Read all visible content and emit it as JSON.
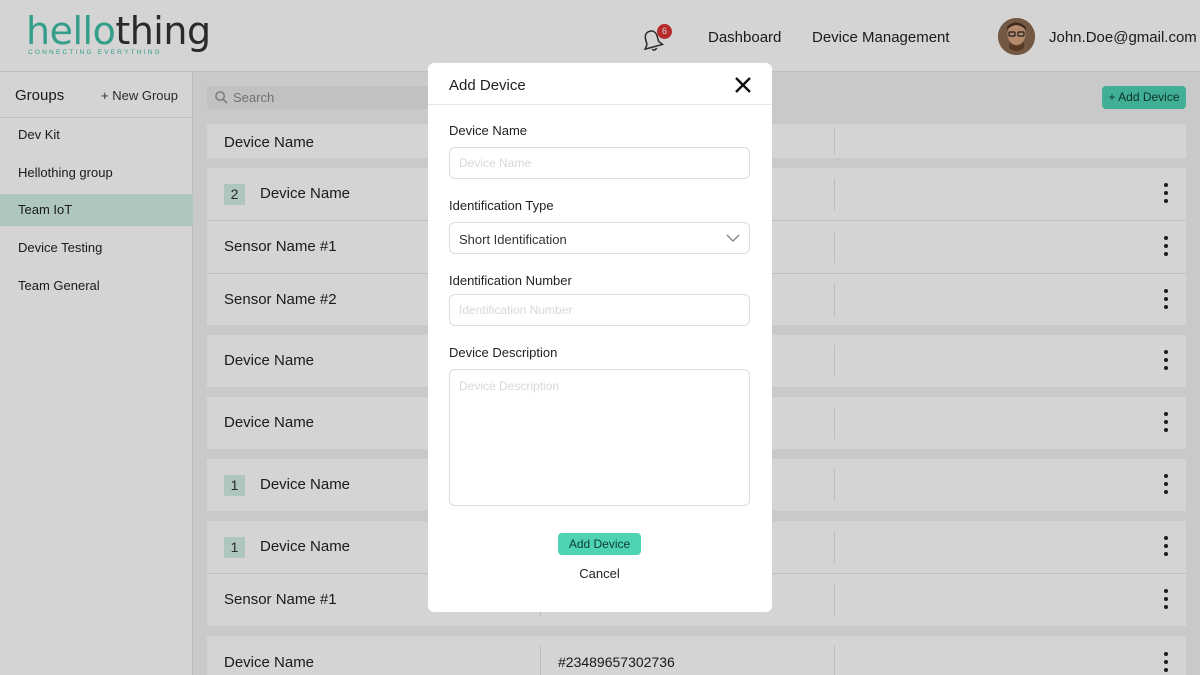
{
  "header": {
    "logo_part1": "hello",
    "logo_part2": "thing",
    "logo_tagline": "CONNECTING EVERYTHING",
    "notification_count": "6",
    "nav": [
      "Dashboard",
      "Device Management"
    ],
    "user_email": "John.Doe@gmail.com"
  },
  "sidebar": {
    "title": "Groups",
    "new_group": "+ New Group",
    "items": [
      {
        "label": "Dev Kit",
        "active": false
      },
      {
        "label": "Hellothing group",
        "active": false
      },
      {
        "label": "Team IoT",
        "active": true
      },
      {
        "label": "Device Testing",
        "active": false
      },
      {
        "label": "Team General",
        "active": false
      }
    ]
  },
  "main": {
    "search_placeholder": "Search",
    "add_device_label": "+ Add Device",
    "column_header": "Device Name",
    "rows": [
      {
        "num": "2",
        "name": "Device Name",
        "id": ""
      },
      {
        "num": "",
        "name": "Sensor Name #1",
        "id": ""
      },
      {
        "num": "",
        "name": "Sensor Name #2",
        "id": ""
      },
      {
        "num": "",
        "name": "Device Name",
        "id": ""
      },
      {
        "num": "",
        "name": "Device Name",
        "id": ""
      },
      {
        "num": "1",
        "name": "Device Name",
        "id": ""
      },
      {
        "num": "1",
        "name": "Device Name",
        "id": ""
      },
      {
        "num": "",
        "name": "Sensor Name #1",
        "id": ""
      },
      {
        "num": "",
        "name": "Device Name",
        "id": "#23489657302736"
      }
    ]
  },
  "modal": {
    "title": "Add Device",
    "device_name_label": "Device Name",
    "device_name_placeholder": "Device Name",
    "id_type_label": "Identification Type",
    "id_type_value": "Short Identification",
    "id_number_label": "Identification Number",
    "id_number_placeholder": "Identification Number",
    "description_label": "Device Description",
    "description_placeholder": "Device Description",
    "submit_label": "Add Device",
    "cancel_label": "Cancel"
  },
  "colors": {
    "accent": "#4fd3b5",
    "brand": "#3fbfa8",
    "active_item": "#d3ede6",
    "badge": "#dd3333"
  }
}
